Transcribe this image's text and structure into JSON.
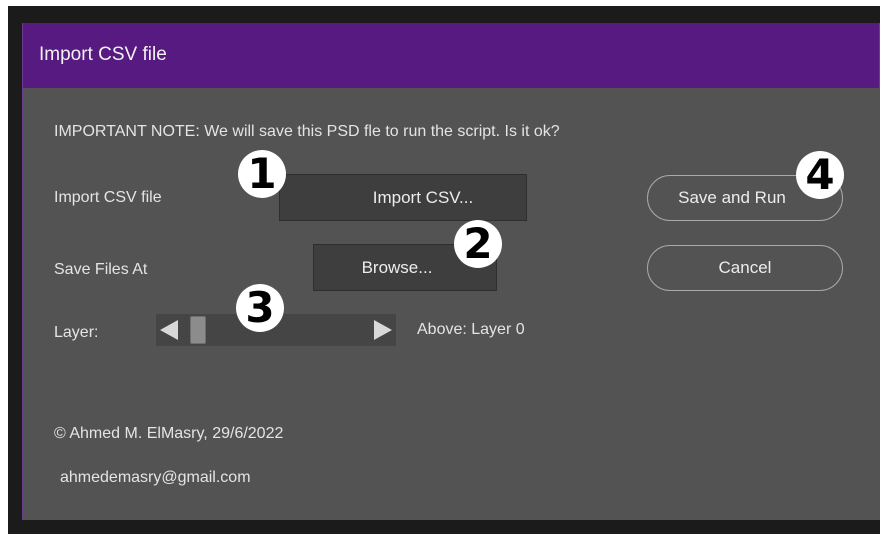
{
  "dialog": {
    "title": "Import CSV file",
    "note": "IMPORTANT NOTE: We will save this PSD fle to run the script. Is it ok?",
    "import_label": "Import CSV file",
    "import_button": "Import CSV...",
    "save_label": "Save Files At",
    "browse_button": "Browse...",
    "layer_label": "Layer:",
    "layer_position": "Above: Layer 0",
    "save_run_button": "Save and Run",
    "cancel_button": "Cancel",
    "copyright": "© Ahmed M. ElMasry, 29/6/2022",
    "email": "ahmedemasry@gmail.com"
  },
  "badges": [
    "1",
    "2",
    "3",
    "4"
  ],
  "colors": {
    "titlebar": "#561a80",
    "dialog_bg": "#535353",
    "frame": "#1b1b1b",
    "button_dark": "#3e3e3e"
  },
  "icons": {
    "slider_left": "triangle-left-icon",
    "slider_right": "triangle-right-icon"
  }
}
